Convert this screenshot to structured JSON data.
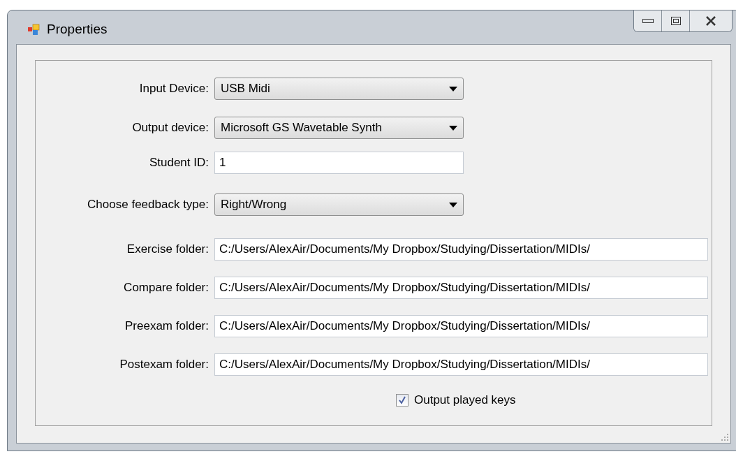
{
  "window": {
    "title": "Properties"
  },
  "fields": [
    {
      "kind": "combo",
      "label": "Input Device:",
      "value": "USB Midi"
    },
    {
      "kind": "combo",
      "label": "Output device:",
      "value": "Microsoft GS Wavetable Synth"
    },
    {
      "kind": "short_text",
      "label": "Student ID:",
      "value": "1"
    },
    {
      "kind": "combo",
      "label": "Choose feedback type:",
      "value": "Right/Wrong"
    },
    {
      "kind": "text",
      "label": "Exercise folder:",
      "value": "C:/Users/AlexAir/Documents/My Dropbox/Studying/Dissertation/MIDIs/"
    },
    {
      "kind": "text",
      "label": "Compare folder:",
      "value": "C:/Users/AlexAir/Documents/My Dropbox/Studying/Dissertation/MIDIs/"
    },
    {
      "kind": "text",
      "label": "Preexam folder:",
      "value": "C:/Users/AlexAir/Documents/My Dropbox/Studying/Dissertation/MIDIs/"
    },
    {
      "kind": "text",
      "label": "Postexam folder:",
      "value": "C:/Users/AlexAir/Documents/My Dropbox/Studying/Dissertation/MIDIs/"
    }
  ],
  "checkbox": {
    "label": "Output played keys",
    "checked": true
  }
}
